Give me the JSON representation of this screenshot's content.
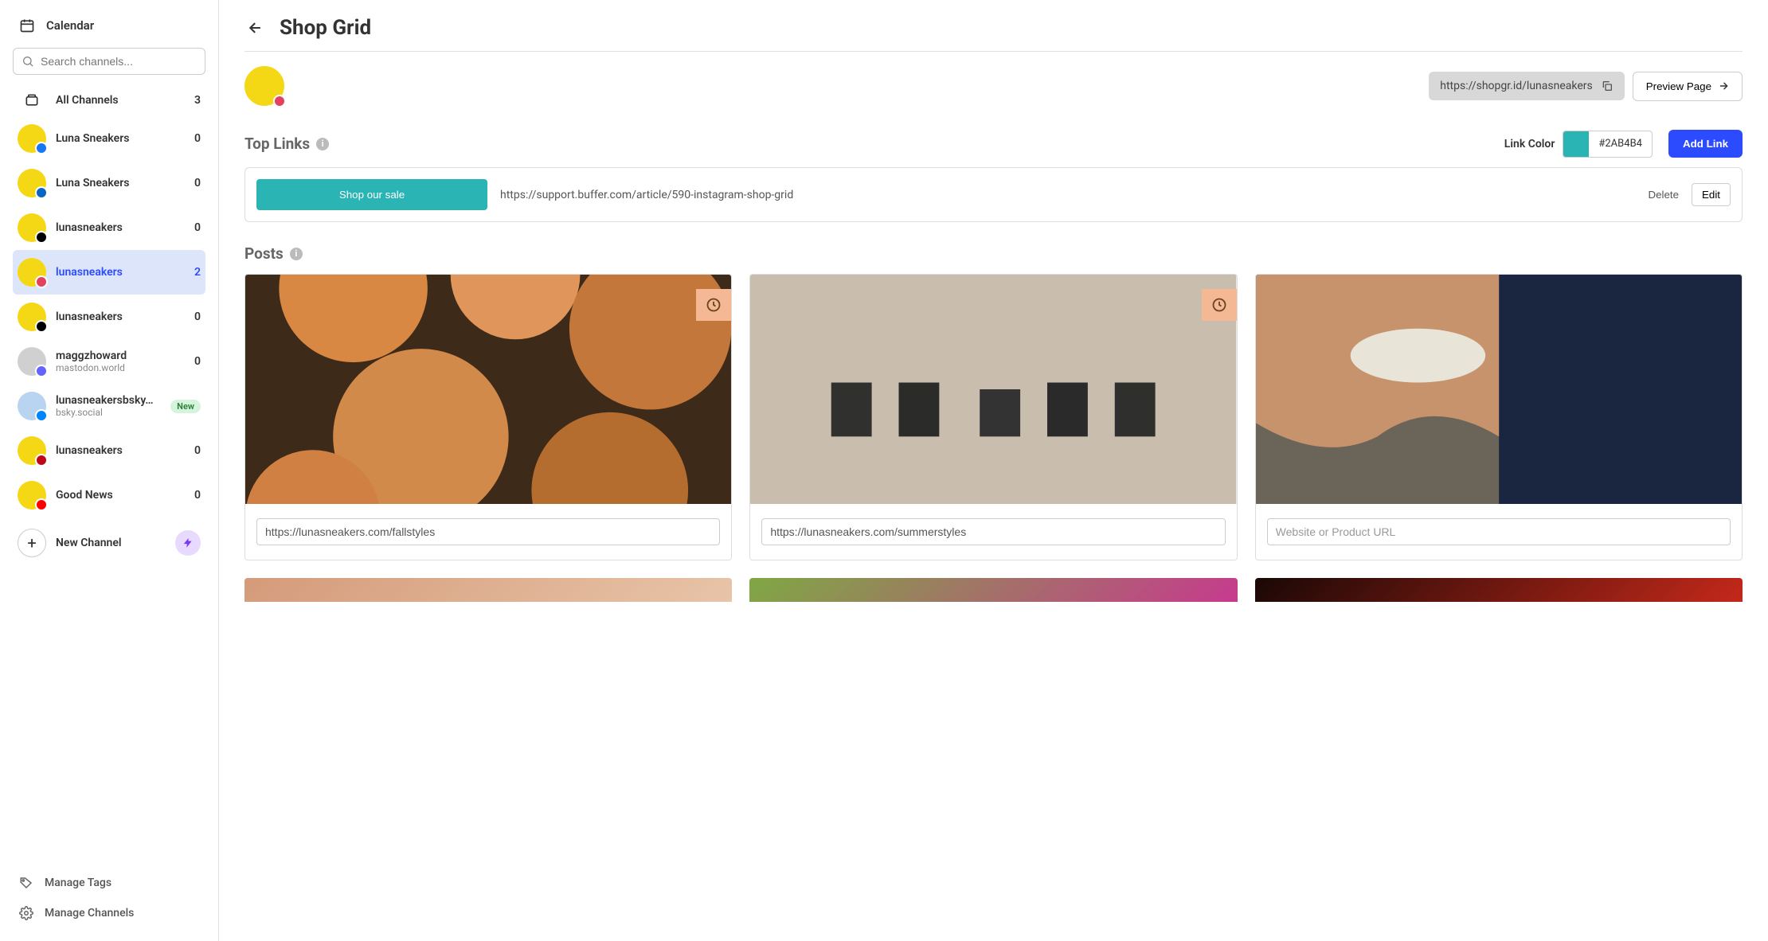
{
  "sidebar": {
    "calendar_label": "Calendar",
    "search_placeholder": "Search channels...",
    "all_channels_label": "All Channels",
    "all_channels_count": "3",
    "channels": [
      {
        "name": "Luna Sneakers",
        "count": "0",
        "network": "fb"
      },
      {
        "name": "Luna Sneakers",
        "count": "0",
        "network": "li"
      },
      {
        "name": "lunasneakers",
        "count": "0",
        "network": "th"
      },
      {
        "name": "lunasneakers",
        "count": "2",
        "network": "ig",
        "active": true
      },
      {
        "name": "lunasneakers",
        "count": "0",
        "network": "tt"
      },
      {
        "name": "maggzhoward",
        "sub": "mastodon.world",
        "count": "0",
        "network": "ma",
        "avatar": "gray"
      },
      {
        "name": "lunasneakersbsky…",
        "sub": "bsky.social",
        "badge": "New",
        "network": "bs",
        "avatar": "blue"
      },
      {
        "name": "lunasneakers",
        "count": "0",
        "network": "pi"
      },
      {
        "name": "Good News",
        "count": "0",
        "network": "yt"
      }
    ],
    "new_channel_label": "New Channel",
    "manage_tags_label": "Manage Tags",
    "manage_channels_label": "Manage Channels"
  },
  "header": {
    "title": "Shop Grid"
  },
  "toolbar": {
    "url": "https://shopgr.id/lunasneakers",
    "preview_label": "Preview Page"
  },
  "top_links": {
    "title": "Top Links",
    "color_label": "Link Color",
    "color_hex": "#2AB4B4",
    "add_link_label": "Add Link",
    "items": [
      {
        "button_label": "Shop our sale",
        "url": "https://support.buffer.com/article/590-instagram-shop-grid"
      }
    ],
    "delete_label": "Delete",
    "edit_label": "Edit"
  },
  "posts": {
    "title": "Posts",
    "url_placeholder": "Website or Product URL",
    "items": [
      {
        "url": "https://lunasneakers.com/fallstyles",
        "scheduled": true
      },
      {
        "url": "https://lunasneakers.com/summerstyles",
        "scheduled": true
      },
      {
        "url": "",
        "scheduled": false
      }
    ]
  }
}
